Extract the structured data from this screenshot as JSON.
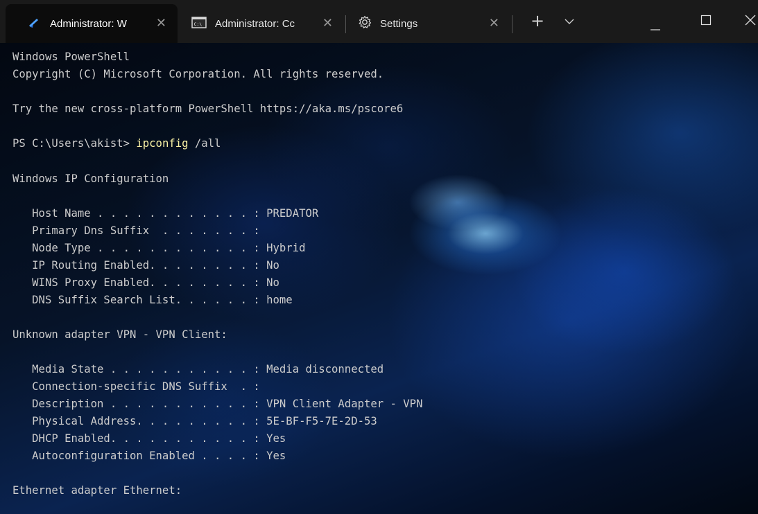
{
  "tabs": [
    {
      "label": "Administrator: W",
      "icon": "powershell-icon",
      "active": true
    },
    {
      "label": "Administrator: Cc",
      "icon": "cmd-icon",
      "active": false
    },
    {
      "label": "Settings",
      "icon": "gear-icon",
      "active": false
    }
  ],
  "titlebar": {
    "new_tab_icon": "plus-icon",
    "dropdown_icon": "chevron-down-icon",
    "minimize_icon": "minimize-icon",
    "maximize_icon": "maximize-icon",
    "close_icon": "close-icon"
  },
  "terminal": {
    "header_1": "Windows PowerShell",
    "header_2": "Copyright (C) Microsoft Corporation. All rights reserved.",
    "promo": "Try the new cross-platform PowerShell https://aka.ms/pscore6",
    "prompt": "PS C:\\Users\\akist> ",
    "command": "ipconfig",
    "args": " /all",
    "section_1": "Windows IP Configuration",
    "ip_config": [
      "   Host Name . . . . . . . . . . . . : PREDATOR",
      "   Primary Dns Suffix  . . . . . . . :",
      "   Node Type . . . . . . . . . . . . : Hybrid",
      "   IP Routing Enabled. . . . . . . . : No",
      "   WINS Proxy Enabled. . . . . . . . : No",
      "   DNS Suffix Search List. . . . . . : home"
    ],
    "section_2": "Unknown adapter VPN - VPN Client:",
    "vpn": [
      "   Media State . . . . . . . . . . . : Media disconnected",
      "   Connection-specific DNS Suffix  . :",
      "   Description . . . . . . . . . . . : VPN Client Adapter - VPN",
      "   Physical Address. . . . . . . . . : 5E-BF-F5-7E-2D-53",
      "   DHCP Enabled. . . . . . . . . . . : Yes",
      "   Autoconfiguration Enabled . . . . : Yes"
    ],
    "section_3": "Ethernet adapter Ethernet:"
  },
  "colors": {
    "text": "#cccccc",
    "command_highlight": "#f9f1a5",
    "titlebar_bg": "#1a1a1a",
    "active_tab_bg": "#0c0c0c"
  }
}
